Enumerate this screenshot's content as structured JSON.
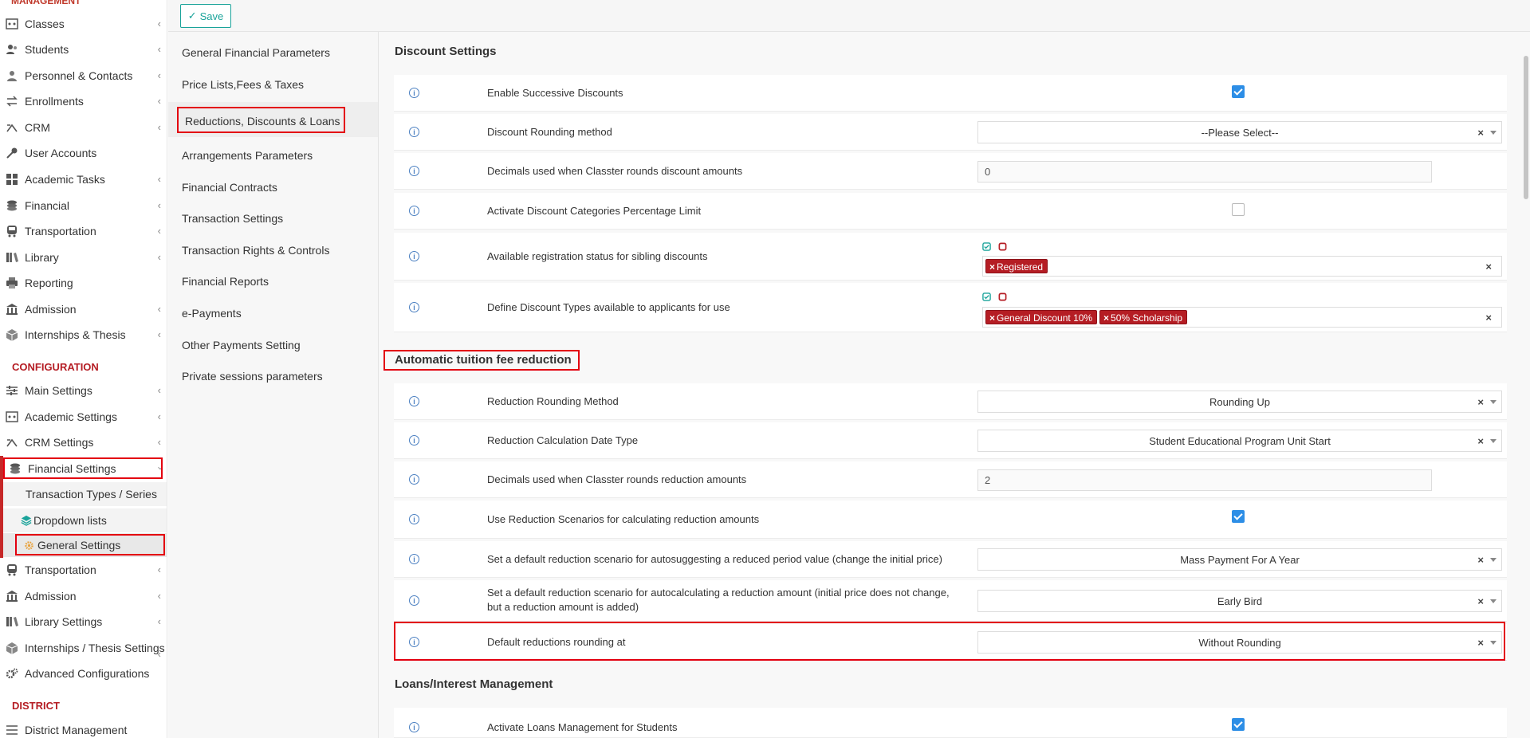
{
  "sidebar": {
    "top_cut_label": "MANAGEMENT",
    "management_items": [
      {
        "label": "Classes",
        "icon": "classes-icon"
      },
      {
        "label": "Students",
        "icon": "students-icon"
      },
      {
        "label": "Personnel & Contacts",
        "icon": "personnel-icon"
      },
      {
        "label": "Enrollments",
        "icon": "enrollments-icon"
      },
      {
        "label": "CRM",
        "icon": "crm-icon"
      },
      {
        "label": "User Accounts",
        "icon": "key-icon"
      },
      {
        "label": "Academic Tasks",
        "icon": "grid-icon"
      },
      {
        "label": "Financial",
        "icon": "coins-icon"
      },
      {
        "label": "Transportation",
        "icon": "bus-icon"
      },
      {
        "label": "Library",
        "icon": "books-icon"
      },
      {
        "label": "Reporting",
        "icon": "printer-icon"
      },
      {
        "label": "Admission",
        "icon": "institution-icon"
      },
      {
        "label": "Internships & Thesis",
        "icon": "cube-icon"
      }
    ],
    "configuration_label": "CONFIGURATION",
    "configuration_items": [
      {
        "label": "Main Settings",
        "icon": "sliders-icon"
      },
      {
        "label": "Academic Settings",
        "icon": "classes-icon"
      },
      {
        "label": "CRM Settings",
        "icon": "crm-icon"
      },
      {
        "label": "Financial Settings",
        "icon": "coins-icon"
      }
    ],
    "financial_sub": [
      {
        "label": "Transaction Types / Series"
      },
      {
        "label": "Dropdown lists"
      },
      {
        "label": "General Settings"
      }
    ],
    "configuration_items_2": [
      {
        "label": "Transportation",
        "icon": "bus-icon"
      },
      {
        "label": "Admission",
        "icon": "institution-icon"
      },
      {
        "label": "Library Settings",
        "icon": "books-icon"
      },
      {
        "label": "Internships / Thesis Settings",
        "icon": "cube-icon"
      },
      {
        "label": "Advanced Configurations",
        "icon": "gears-icon"
      }
    ],
    "district_label": "DISTRICT",
    "district_items": [
      {
        "label": "District Management",
        "icon": "list-icon"
      }
    ]
  },
  "toolbar": {
    "save_label": "Save"
  },
  "settings_menu": [
    "General Financial Parameters",
    "Price Lists,Fees & Taxes",
    "Reductions, Discounts & Loans",
    "Arrangements Parameters",
    "Financial Contracts",
    "Transaction Settings",
    "Transaction Rights & Controls",
    "Financial Reports",
    "e-Payments",
    "Other Payments Setting",
    "Private sessions parameters"
  ],
  "sections": {
    "discount": {
      "title": "Discount Settings",
      "rows": [
        {
          "label": "Enable Successive Discounts",
          "checked": true
        },
        {
          "label": "Discount Rounding method",
          "value": "--Please Select--"
        },
        {
          "label": "Decimals used when Classter rounds discount amounts",
          "value": "0"
        },
        {
          "label": "Activate Discount Categories Percentage Limit",
          "checked": false
        },
        {
          "label": "Available registration status for sibling discounts",
          "tags": [
            "Registered"
          ]
        },
        {
          "label": "Define Discount Types available to applicants for use",
          "tags": [
            "General Discount 10%",
            "50% Scholarship"
          ]
        }
      ]
    },
    "reduction": {
      "title": "Automatic tuition fee reduction",
      "rows": [
        {
          "label": "Reduction Rounding Method",
          "value": "Rounding Up"
        },
        {
          "label": "Reduction Calculation Date Type",
          "value": "Student Educational Program Unit Start"
        },
        {
          "label": "Decimals used when Classter rounds reduction amounts",
          "value": "2"
        },
        {
          "label": "Use Reduction Scenarios for calculating reduction amounts",
          "checked": true
        },
        {
          "label": "Set a default reduction scenario for autosuggesting a reduced period value (change the initial price)",
          "value": "Mass Payment For A Year"
        },
        {
          "label": "Set a default reduction scenario for autocalculating a reduction amount (initial price does not change, but a reduction amount is added)",
          "value": "Early Bird"
        },
        {
          "label": "Default reductions rounding at",
          "value": "Without Rounding"
        }
      ]
    },
    "loans": {
      "title": "Loans/Interest Management",
      "rows": [
        {
          "label": "Activate Loans Management for Students",
          "checked": true
        }
      ]
    }
  },
  "glyphs": {
    "x": "×",
    "info": "i",
    "check": "✓",
    "chev": "‹"
  },
  "colors": {
    "accent": "#1aa39a",
    "danger": "#b51d24",
    "highlight": "#e3000f",
    "checkbox": "#2d8ee6"
  }
}
